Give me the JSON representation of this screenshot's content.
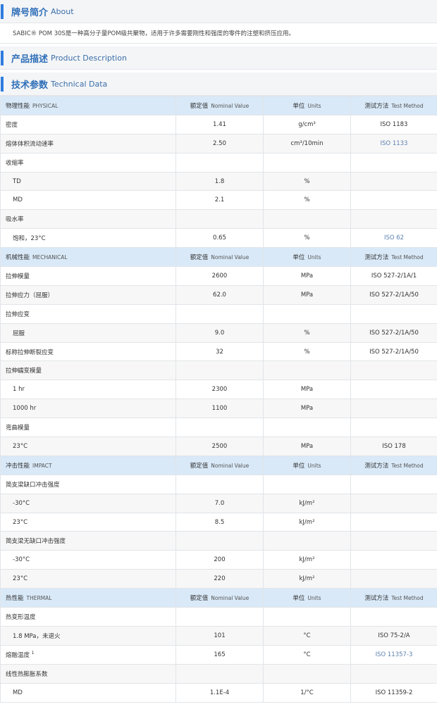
{
  "about": {
    "title_zh": "牌号简介",
    "title_en": "About",
    "text": "SABIC® POM 30S是一种高分子量POM级共聚物，适用于许多需要刚性和强度的零件的注塑和挤压应用。"
  },
  "product": {
    "title_zh": "产品描述",
    "title_en": "Product Description"
  },
  "tech": {
    "title_zh": "技术参数",
    "title_en": "Technical Data"
  },
  "colors": {
    "accent": "#2f7de1",
    "header_bg": "#d9e9f8",
    "link": "#5b7fb0"
  },
  "table": {
    "header_cols": {
      "nominal_zh": "额定值",
      "nominal_en": "Nominal Value",
      "units_zh": "单位",
      "units_en": "Units",
      "method_zh": "测试方法",
      "method_en": "Test Method"
    },
    "rows": [
      {
        "type": "hdr",
        "zh": "物理性能",
        "en": "PHYSICAL"
      },
      {
        "type": "row",
        "label": "密度",
        "value": "1.41",
        "unit": "g/cm³",
        "method": "ISO 1183"
      },
      {
        "type": "row",
        "label": "熔体体积流动速率",
        "value": "2.50",
        "unit": "cm³/10min",
        "method": "ISO 1133",
        "link": true
      },
      {
        "type": "row",
        "label": "收缩率",
        "value": "",
        "unit": "",
        "method": ""
      },
      {
        "type": "row",
        "label": "TD",
        "sub": true,
        "value": "1.8",
        "unit": "%",
        "method": ""
      },
      {
        "type": "row",
        "label": "MD",
        "sub": true,
        "value": "2.1",
        "unit": "%",
        "method": ""
      },
      {
        "type": "row",
        "label": "吸水率",
        "value": "",
        "unit": "",
        "method": ""
      },
      {
        "type": "row",
        "label": "饱和，23°C",
        "sub": true,
        "value": "0.65",
        "unit": "%",
        "method": "ISO 62",
        "link": true
      },
      {
        "type": "hdr",
        "zh": "机械性能",
        "en": "MECHANICAL"
      },
      {
        "type": "row",
        "label": "拉伸模量",
        "value": "2600",
        "unit": "MPa",
        "method": "ISO 527-2/1A/1"
      },
      {
        "type": "row",
        "label": "拉伸应力（屈服）",
        "value": "62.0",
        "unit": "MPa",
        "method": "ISO 527-2/1A/50"
      },
      {
        "type": "row",
        "label": "拉伸应变",
        "value": "",
        "unit": "",
        "method": ""
      },
      {
        "type": "row",
        "label": "屈服",
        "sub": true,
        "value": "9.0",
        "unit": "%",
        "method": "ISO 527-2/1A/50"
      },
      {
        "type": "row",
        "label": "标称拉伸断裂应变",
        "value": "32",
        "unit": "%",
        "method": "ISO 527-2/1A/50"
      },
      {
        "type": "row",
        "label": "拉伸蠕变模量",
        "value": "",
        "unit": "",
        "method": ""
      },
      {
        "type": "row",
        "label": "1 hr",
        "sub": true,
        "value": "2300",
        "unit": "MPa",
        "method": ""
      },
      {
        "type": "row",
        "label": "1000 hr",
        "sub": true,
        "value": "1100",
        "unit": "MPa",
        "method": ""
      },
      {
        "type": "row",
        "label": "弯曲模量",
        "value": "",
        "unit": "",
        "method": ""
      },
      {
        "type": "row",
        "label": "23°C",
        "sub": true,
        "value": "2500",
        "unit": "MPa",
        "method": "ISO 178"
      },
      {
        "type": "hdr",
        "zh": "冲击性能",
        "en": "IMPACT"
      },
      {
        "type": "row",
        "label": "简支梁缺口冲击强度",
        "value": "",
        "unit": "",
        "method": ""
      },
      {
        "type": "row",
        "label": "-30°C",
        "sub": true,
        "value": "7.0",
        "unit": "kJ/m²",
        "method": ""
      },
      {
        "type": "row",
        "label": "23°C",
        "sub": true,
        "value": "8.5",
        "unit": "kJ/m²",
        "method": ""
      },
      {
        "type": "row",
        "label": "简支梁无缺口冲击强度",
        "value": "",
        "unit": "",
        "method": ""
      },
      {
        "type": "row",
        "label": "-30°C",
        "sub": true,
        "value": "200",
        "unit": "kJ/m²",
        "method": ""
      },
      {
        "type": "row",
        "label": "23°C",
        "sub": true,
        "value": "220",
        "unit": "kJ/m²",
        "method": ""
      },
      {
        "type": "hdr",
        "zh": "热性能",
        "en": "THERMAL"
      },
      {
        "type": "row",
        "label": "热变形温度",
        "value": "",
        "unit": "",
        "method": ""
      },
      {
        "type": "row",
        "label": "1.8 MPa，未退火",
        "sub": true,
        "value": "101",
        "unit": "°C",
        "method": "ISO 75-2/A"
      },
      {
        "type": "row",
        "label": "熔融温度",
        "sup": "1",
        "value": "165",
        "unit": "°C",
        "method": "ISO 11357-3",
        "link": true
      },
      {
        "type": "row",
        "label": "线性热膨胀系数",
        "value": "",
        "unit": "",
        "method": ""
      },
      {
        "type": "row",
        "label": "MD",
        "sub": true,
        "value": "1.1E-4",
        "unit": "1/°C",
        "method": "ISO 11359-2"
      }
    ]
  }
}
